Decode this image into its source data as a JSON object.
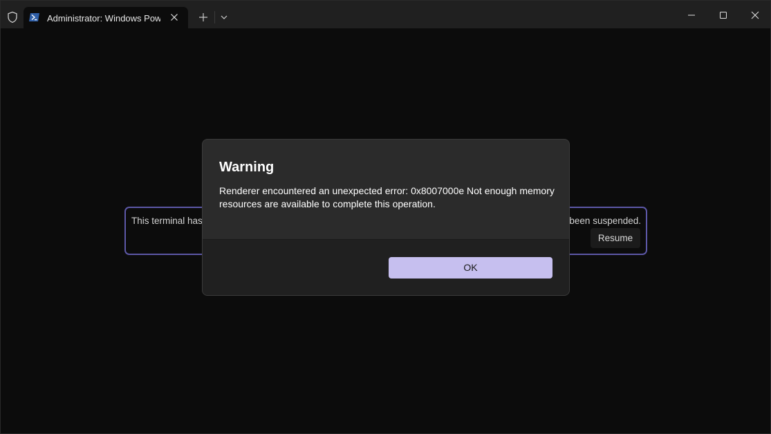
{
  "titlebar": {
    "tab_title": "Administrator: Windows PowerShell",
    "icons": {
      "shield": "shield-icon",
      "tab": "powershell-icon",
      "tab_close": "close-icon",
      "new_tab": "plus-icon",
      "dropdown": "chevron-down-icon",
      "minimize": "minimize-icon",
      "maximize": "maximize-icon",
      "close": "close-icon"
    }
  },
  "terminal": {
    "suspend_message_left": "This terminal has",
    "suspend_message_right": "been suspended.",
    "resume_label": "Resume",
    "accent_color": "#5d58a8"
  },
  "dialog": {
    "title": "Warning",
    "message": "Renderer encountered an unexpected error: 0x8007000e Not enough memory resources are available to complete this operation.",
    "ok_label": "OK",
    "accent_color": "#c6bfef"
  }
}
